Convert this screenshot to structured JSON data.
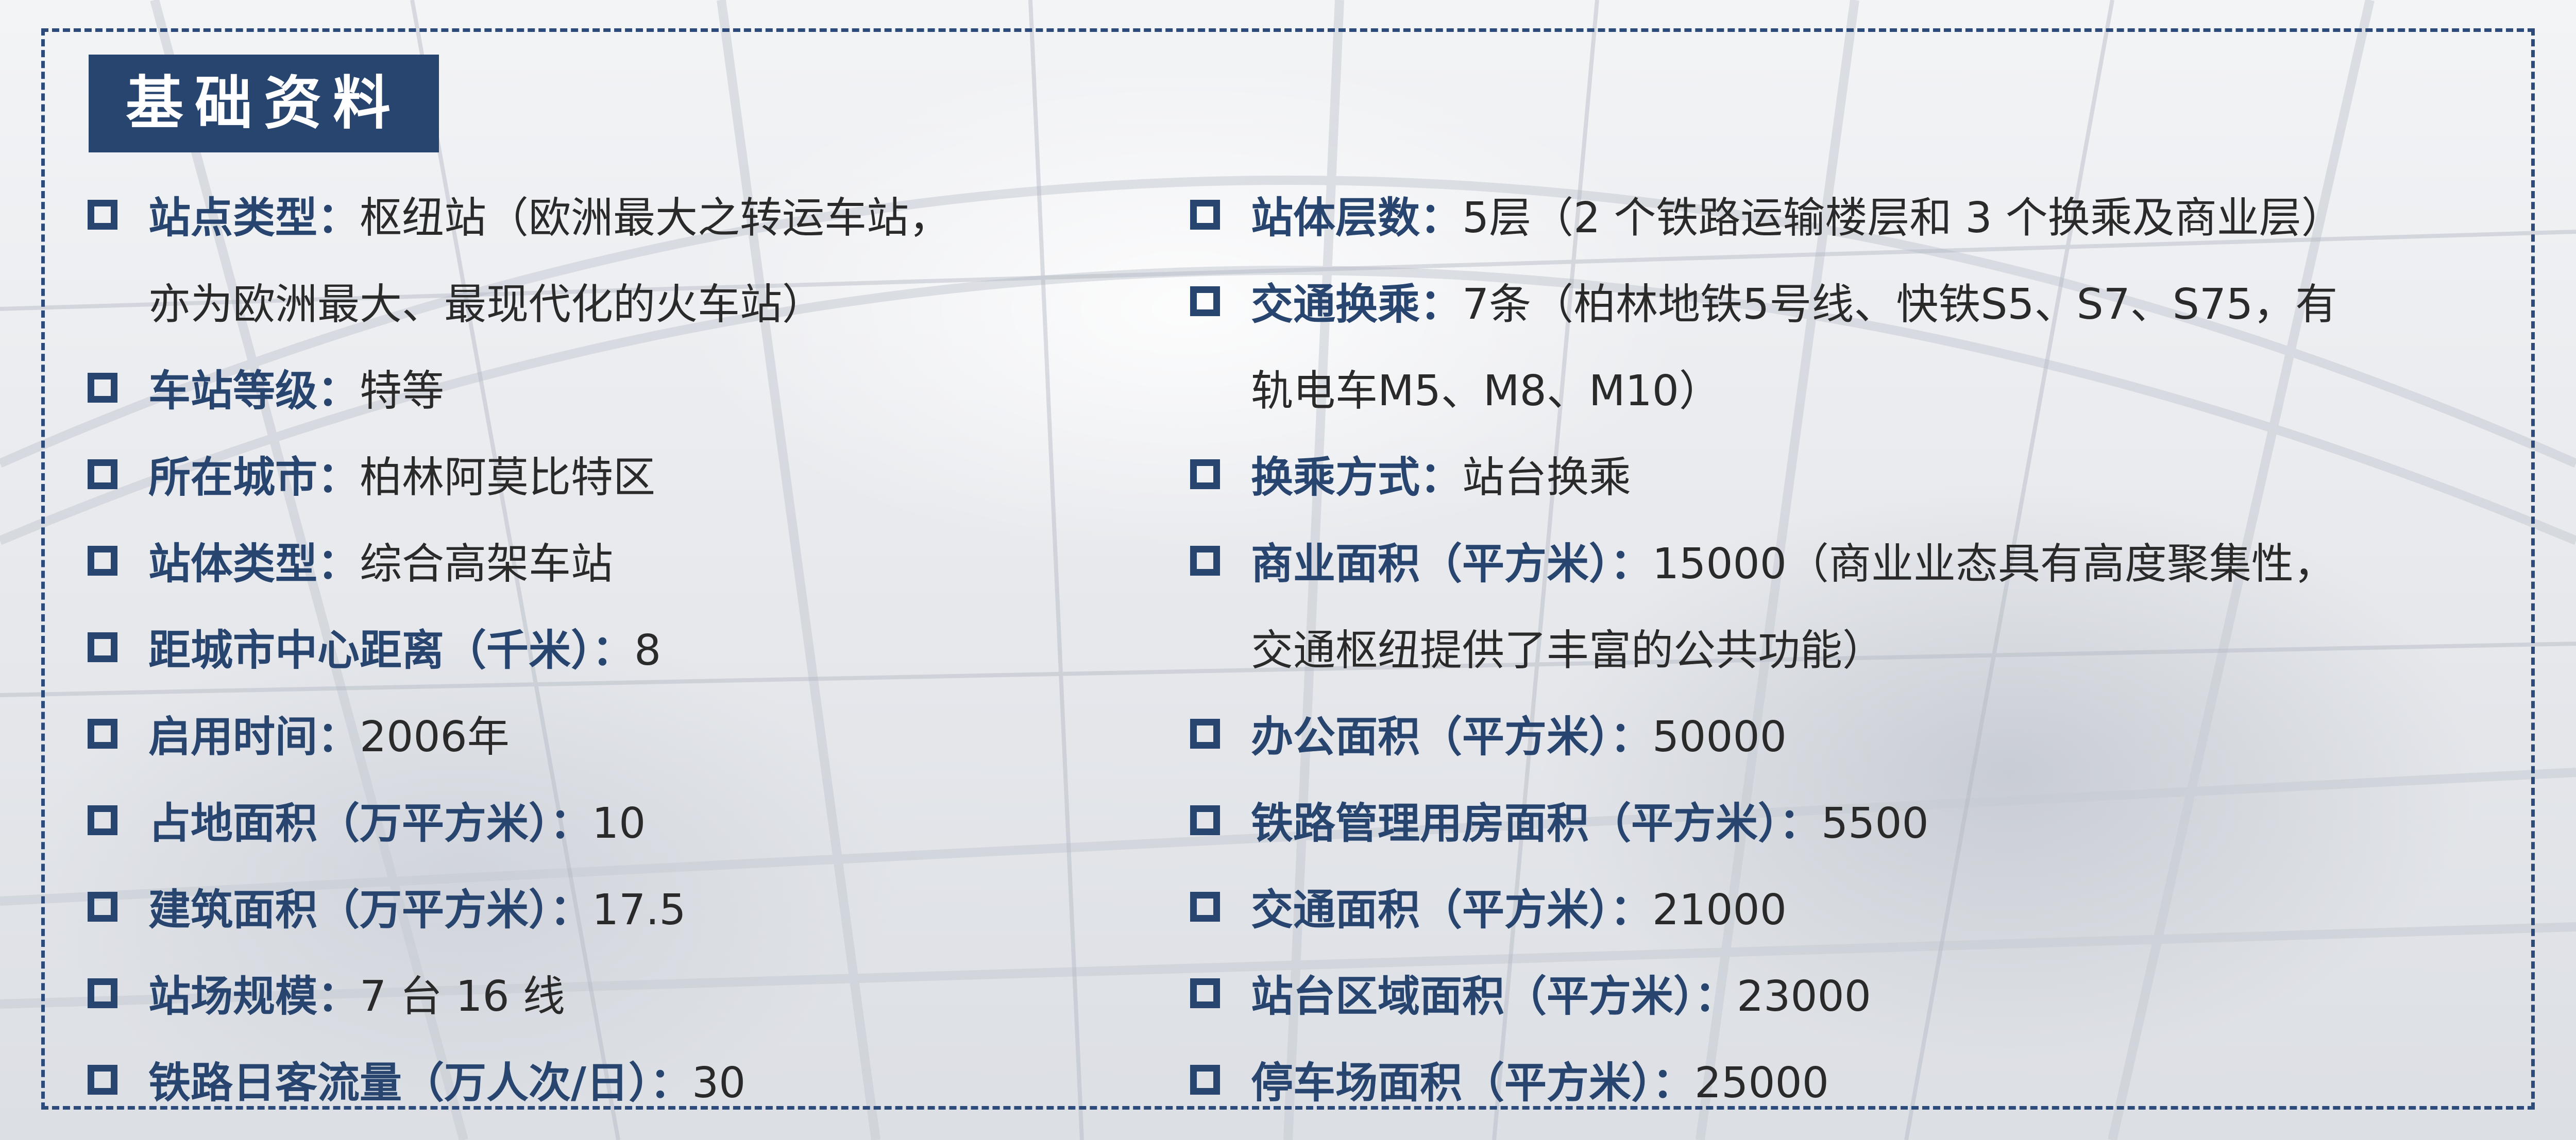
{
  "title": "基础资料",
  "left_items": [
    {
      "label": "站点类型：",
      "value": "枢纽站（欧洲最大之转运车站，",
      "cont": "亦为欧洲最大、最现代化的火车站）"
    },
    {
      "label": "车站等级：",
      "value": "特等"
    },
    {
      "label": "所在城市：",
      "value": "柏林阿莫比特区"
    },
    {
      "label": "站体类型：",
      "value": "综合高架车站"
    },
    {
      "label": "距城市中心距离（千米）：",
      "value": "8"
    },
    {
      "label": "启用时间：",
      "value": "2006年"
    },
    {
      "label": "占地面积（万平方米）：",
      "value": "10"
    },
    {
      "label": "建筑面积（万平方米）：",
      "value": "17.5"
    },
    {
      "label": "站场规模：",
      "value": "7 台 16 线"
    },
    {
      "label": "铁路日客流量（万人次/日）：",
      "value": "30"
    }
  ],
  "right_items": [
    {
      "label": "站体层数：",
      "value": "5层（2 个铁路运输楼层和 3 个换乘及商业层）"
    },
    {
      "label": "交通换乘：",
      "value": "7条（柏林地铁5号线、快铁S5、S7、S75，有",
      "cont": "轨电车M5、M8、M10）"
    },
    {
      "label": "换乘方式：",
      "value": "站台换乘"
    },
    {
      "label": "商业面积（平方米）：",
      "value": "15000（商业业态具有高度聚集性，",
      "cont": "交通枢纽提供了丰富的公共功能）"
    },
    {
      "label": "办公面积（平方米）：",
      "value": "50000"
    },
    {
      "label": "铁路管理用房面积（平方米）：",
      "value": "5500"
    },
    {
      "label": "交通面积（平方米）：",
      "value": "21000"
    },
    {
      "label": "站台区域面积（平方米）：",
      "value": "23000"
    },
    {
      "label": "停车场面积（平方米）：",
      "value": "25000"
    }
  ],
  "colors": {
    "accent": "#27456f",
    "text": "#2a2a2a",
    "border": "#2c4a7a"
  }
}
